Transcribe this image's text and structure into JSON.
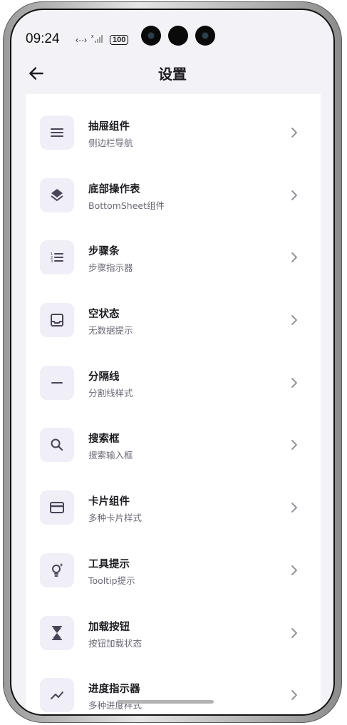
{
  "status": {
    "time": "09:24",
    "battery": "100"
  },
  "appbar": {
    "title": "设置"
  },
  "items": [
    {
      "title": "抽屉组件",
      "subtitle": "侧边栏导航",
      "icon": "menu-icon"
    },
    {
      "title": "底部操作表",
      "subtitle": "BottomSheet组件",
      "icon": "layers-icon"
    },
    {
      "title": "步骤条",
      "subtitle": "步骤指示器",
      "icon": "numbered-list-icon"
    },
    {
      "title": "空状态",
      "subtitle": "无数据提示",
      "icon": "inbox-icon"
    },
    {
      "title": "分隔线",
      "subtitle": "分割线样式",
      "icon": "horizontal-rule-icon"
    },
    {
      "title": "搜索框",
      "subtitle": "搜索输入框",
      "icon": "search-icon"
    },
    {
      "title": "卡片组件",
      "subtitle": "多种卡片样式",
      "icon": "credit-card-icon"
    },
    {
      "title": "工具提示",
      "subtitle": "Tooltip提示",
      "icon": "lightbulb-icon"
    },
    {
      "title": "加载按钮",
      "subtitle": "按钮加载状态",
      "icon": "hourglass-icon"
    },
    {
      "title": "进度指示器",
      "subtitle": "多种进度样式",
      "icon": "trending-icon"
    }
  ],
  "colors": {
    "accent": "#4a4458",
    "icon_bg": "#f0eef6",
    "appbar_bg": "#f3f2f6"
  }
}
